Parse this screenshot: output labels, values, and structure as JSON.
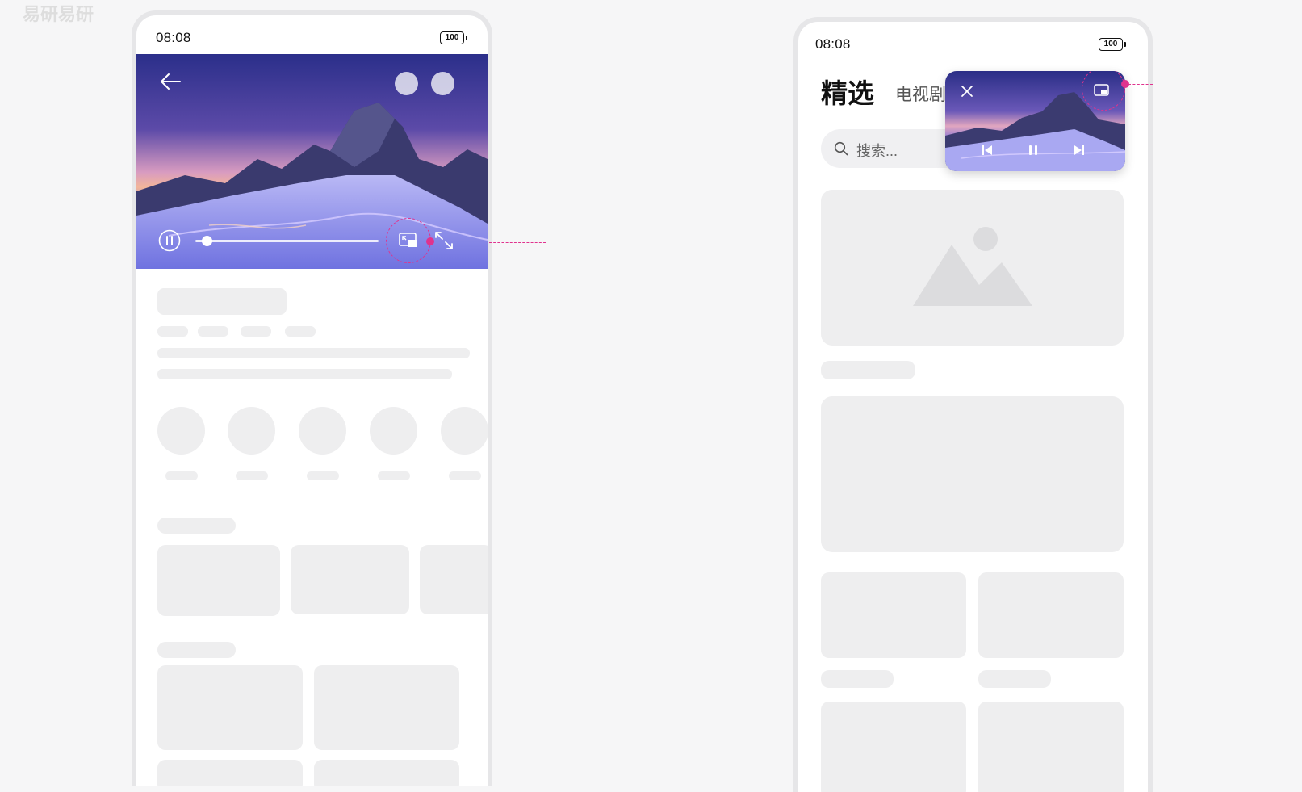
{
  "watermark": "易研易研",
  "left_phone": {
    "time": "08:08",
    "battery": "100",
    "player": {
      "progress": 0.06,
      "icons": [
        "back-arrow-icon",
        "pause-icon",
        "picture-in-picture-icon",
        "fullscreen-icon"
      ]
    }
  },
  "right_phone": {
    "time": "08:08",
    "battery": "100",
    "tabs": {
      "active": "精选",
      "next": "电视剧"
    },
    "search": {
      "placeholder": "搜索..."
    },
    "mini_player": {
      "icons": [
        "close-icon",
        "restore-window-icon",
        "previous-icon",
        "pause-icon",
        "next-icon"
      ]
    }
  },
  "colors": {
    "accent": "#e0338e",
    "skeleton": "#eeeeef",
    "frame": "#e6e6e8"
  }
}
